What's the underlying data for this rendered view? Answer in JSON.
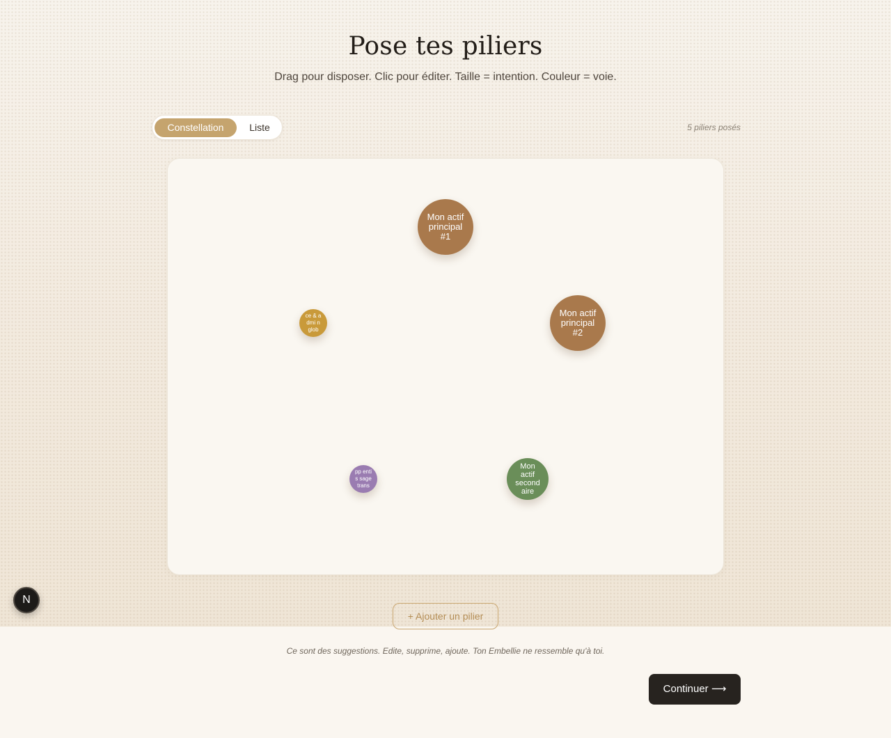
{
  "header": {
    "title": "Pose tes piliers",
    "subtitle": "Drag pour disposer. Clic pour éditer. Taille = intention. Couleur = voie."
  },
  "view_toggle": {
    "options": [
      "Constellation",
      "Liste"
    ],
    "selected": "Constellation"
  },
  "pillar_count": "5 piliers posés",
  "pillars": [
    {
      "label": "Mon actif principal #1",
      "color": "#a9794c"
    },
    {
      "label": "Mon actif principal #2",
      "color": "#a9794c"
    },
    {
      "label": "ce & admi n glob",
      "color": "#c99a3a"
    },
    {
      "label": "pp entis sage trans",
      "color": "#9a7cb1"
    },
    {
      "label": "Mon actif second aire",
      "color": "#6a8e59"
    }
  ],
  "actions": {
    "add_pillar": "+ Ajouter un pilier",
    "continue": "Continuer ⟶"
  },
  "footer_note": "Ce sont des suggestions. Edite, supprime, ajoute. Ton Embellie ne ressemble qu'à toi.",
  "dev_badge": "N",
  "colors": {
    "accent": "#c5a46e",
    "primary_button": "#27231f"
  }
}
